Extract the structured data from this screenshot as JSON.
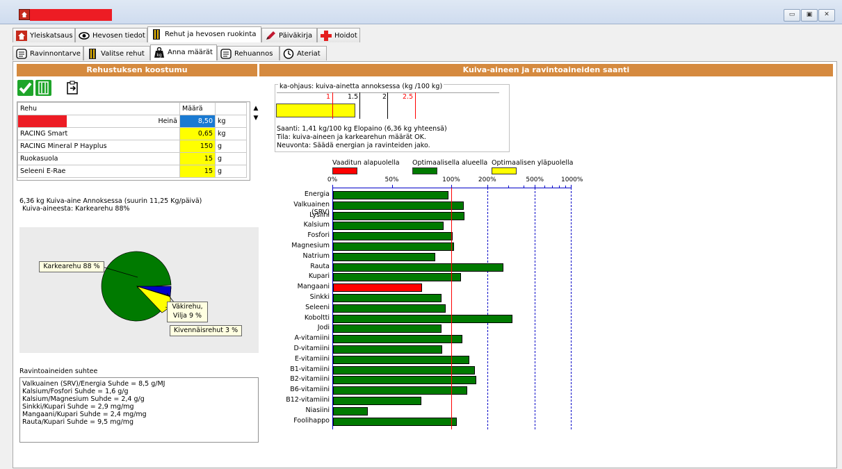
{
  "tabs_main": [
    {
      "label": "Yleiskatsaus",
      "icon": "house-icon"
    },
    {
      "label": "Hevosen tiedot",
      "icon": "eye-icon"
    },
    {
      "label": "Rehut ja hevosen ruokinta",
      "icon": "feed-icon"
    },
    {
      "label": "Päiväkirja",
      "icon": "pen-icon"
    },
    {
      "label": "Hoidot",
      "icon": "cross-icon"
    }
  ],
  "tabs_sub": [
    {
      "label": "Ravinnontarve",
      "icon": "document-icon"
    },
    {
      "label": "Valitse rehut",
      "icon": "feed-icon"
    },
    {
      "label": "Anna määrät",
      "icon": "scale-icon"
    },
    {
      "label": "Rehuannos",
      "icon": "document-icon"
    },
    {
      "label": "Ateriat",
      "icon": "clock-icon"
    }
  ],
  "headers": {
    "left": "Rehustuksen koostumu",
    "right": "Kuiva-aineen ja ravintoaineiden saanti"
  },
  "feed_table": {
    "col_feed": "Rehu",
    "col_amount": "Määrä",
    "rows": [
      {
        "name": "Heinä",
        "amount": "8,50",
        "unit": "kg"
      },
      {
        "name": "RACING Smart",
        "amount": "0,65",
        "unit": "kg"
      },
      {
        "name": "RACING Mineral P Hayplus",
        "amount": "150",
        "unit": "g"
      },
      {
        "name": "Ruokasuola",
        "amount": "15",
        "unit": "g"
      },
      {
        "name": "Seleeni E-Rae",
        "amount": "15",
        "unit": "g"
      }
    ]
  },
  "summary": {
    "line1": "6,36 kg Kuiva-aine Annoksessa (suurin 11,25 Kg/päivä)",
    "line2": "Kuiva-aineesta: Karkearehu 88%"
  },
  "pie": {
    "slices": [
      {
        "label": "Karkearehu 88 %",
        "value": 88,
        "color": "#007a00"
      },
      {
        "label": "Väkirehu, Vilja 9 %",
        "value": 9,
        "color": "#ffff00"
      },
      {
        "label": "Kivennäisrehut 3 %",
        "value": 3,
        "color": "#0000c8"
      }
    ],
    "callout_vakirehu_line1": "Väkirehu,",
    "callout_vakirehu_line2": "Vilja 9 %"
  },
  "ratios": {
    "title": "Ravintoaineiden suhtee",
    "lines": [
      "Valkuainen (SRV)/Energia Suhde = 8,5 g/MJ",
      "Kalsium/Fosfori Suhde = 1,6 g/g",
      "Kalsium/Magnesium Suhde = 2,4 g/g",
      "Sinkki/Kupari Suhde = 2,9 mg/mg",
      "Mangaani/Kupari Suhde = 2,4 mg/mg",
      "Rauta/Kupari Suhde = 9,5 mg/mg"
    ]
  },
  "ka_ohjaus": {
    "title": "ka-ohjaus: kuiva-ainetta annoksessa (kg /100 kg)",
    "ticks": [
      "1",
      "1.5",
      "2",
      "2.5"
    ],
    "value": 1.41,
    "status1": "Saanti: 1,41 kg/100 kg Elopaino (6,36 kg yhteensä)",
    "status2": "Tila: kuiva-aineen ja karkearehun määrät OK.",
    "status3": "Neuvonta: Säädä energian ja ravinteiden jako."
  },
  "legend": {
    "below": "Vaaditun alapuolella",
    "optimal": "Optimaalisella alueella",
    "above": "Optimaalisen yläpuolella",
    "colors": {
      "below": "#ff0000",
      "optimal": "#007a00",
      "above": "#ffff00"
    }
  },
  "chart_data": {
    "type": "bar",
    "orientation": "horizontal",
    "x_tick_labels": [
      "0%",
      "50%",
      "100%",
      "200%",
      "500%",
      "1000%"
    ],
    "scale_note": "piecewise: linear 0-100%, logarithmic above",
    "categories": [
      "Energia",
      "Valkuainen (SRV)",
      "Lysiini",
      "Kalsium",
      "Fosfori",
      "Magnesium",
      "Natrium",
      "Rauta",
      "Kupari",
      "Mangaani",
      "Sinkki",
      "Seleeni",
      "Koboltti",
      "Jodi",
      "A-vitamiini",
      "D-vitamiini",
      "E-vitamiini",
      "B1-vitamiini",
      "B2-vitamiini",
      "B6-vitamiini",
      "B12-vitamiini",
      "Niasiini",
      "Foolihappo"
    ],
    "values": [
      97,
      125,
      127,
      93,
      101,
      104,
      86,
      270,
      119,
      75,
      91,
      95,
      320,
      91,
      123,
      92,
      140,
      155,
      160,
      134,
      74,
      29,
      110
    ],
    "status": [
      "optimal",
      "optimal",
      "optimal",
      "optimal",
      "optimal",
      "optimal",
      "optimal",
      "optimal",
      "optimal",
      "below",
      "optimal",
      "optimal",
      "optimal",
      "optimal",
      "optimal",
      "optimal",
      "optimal",
      "optimal",
      "optimal",
      "optimal",
      "optimal",
      "optimal",
      "optimal"
    ],
    "reference_line": 100
  }
}
